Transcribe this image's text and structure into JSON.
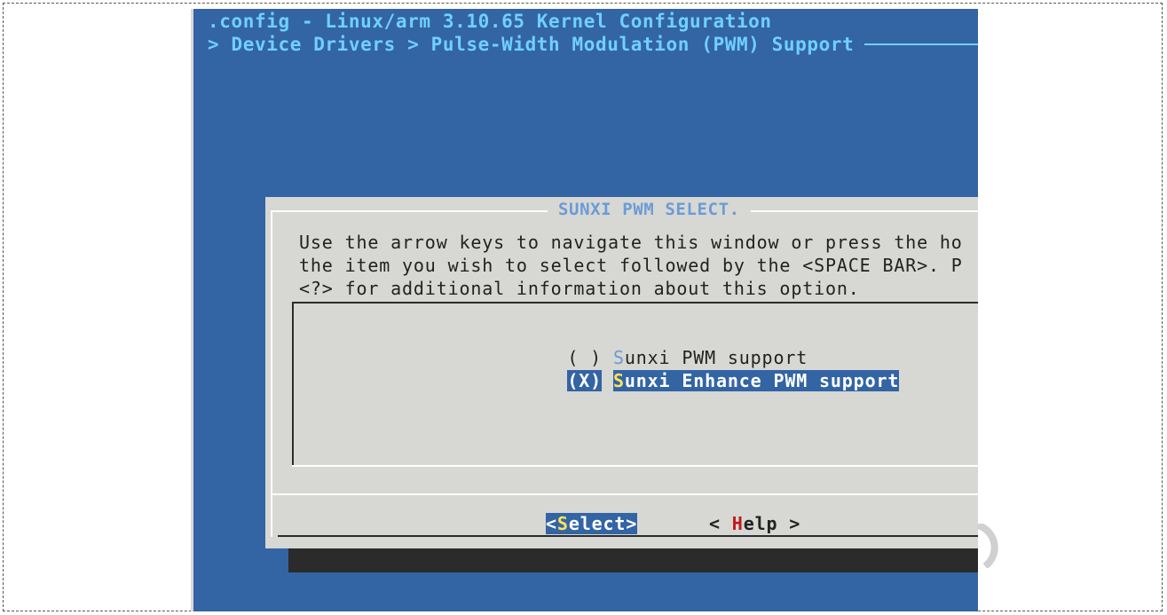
{
  "window": {
    "title": ".config - Linux/arm 3.10.65 Kernel Configuration",
    "breadcrumb": "> Device Drivers > Pulse-Width Modulation (PWM) Support"
  },
  "dialog": {
    "title": "SUNXI PWM SELECT.",
    "help_lines": [
      "Use the arrow keys to navigate this window or press the ho",
      "the item you wish to select followed by the <SPACE BAR>. P",
      "<?> for additional information about this option."
    ],
    "options": [
      {
        "radio": "( )",
        "hotkey": "S",
        "rest": "unxi PWM support",
        "selected": false
      },
      {
        "radio": "(X)",
        "hotkey": "S",
        "rest": "unxi Enhance PWM support",
        "selected": true
      }
    ],
    "buttons": {
      "select": {
        "open": "<",
        "hotkey": "S",
        "rest": "elect>"
      },
      "help": {
        "open": "< ",
        "hotkey": "H",
        "rest": "elp >"
      }
    }
  },
  "colors": {
    "terminal_bg": "#3364a4",
    "title_fg": "#6fd0ff",
    "dialog_bg": "#d7d7d4",
    "highlight": "#3364a4",
    "hotkey_selected": "#ffe25a",
    "hotkey_help": "#c0181c"
  }
}
